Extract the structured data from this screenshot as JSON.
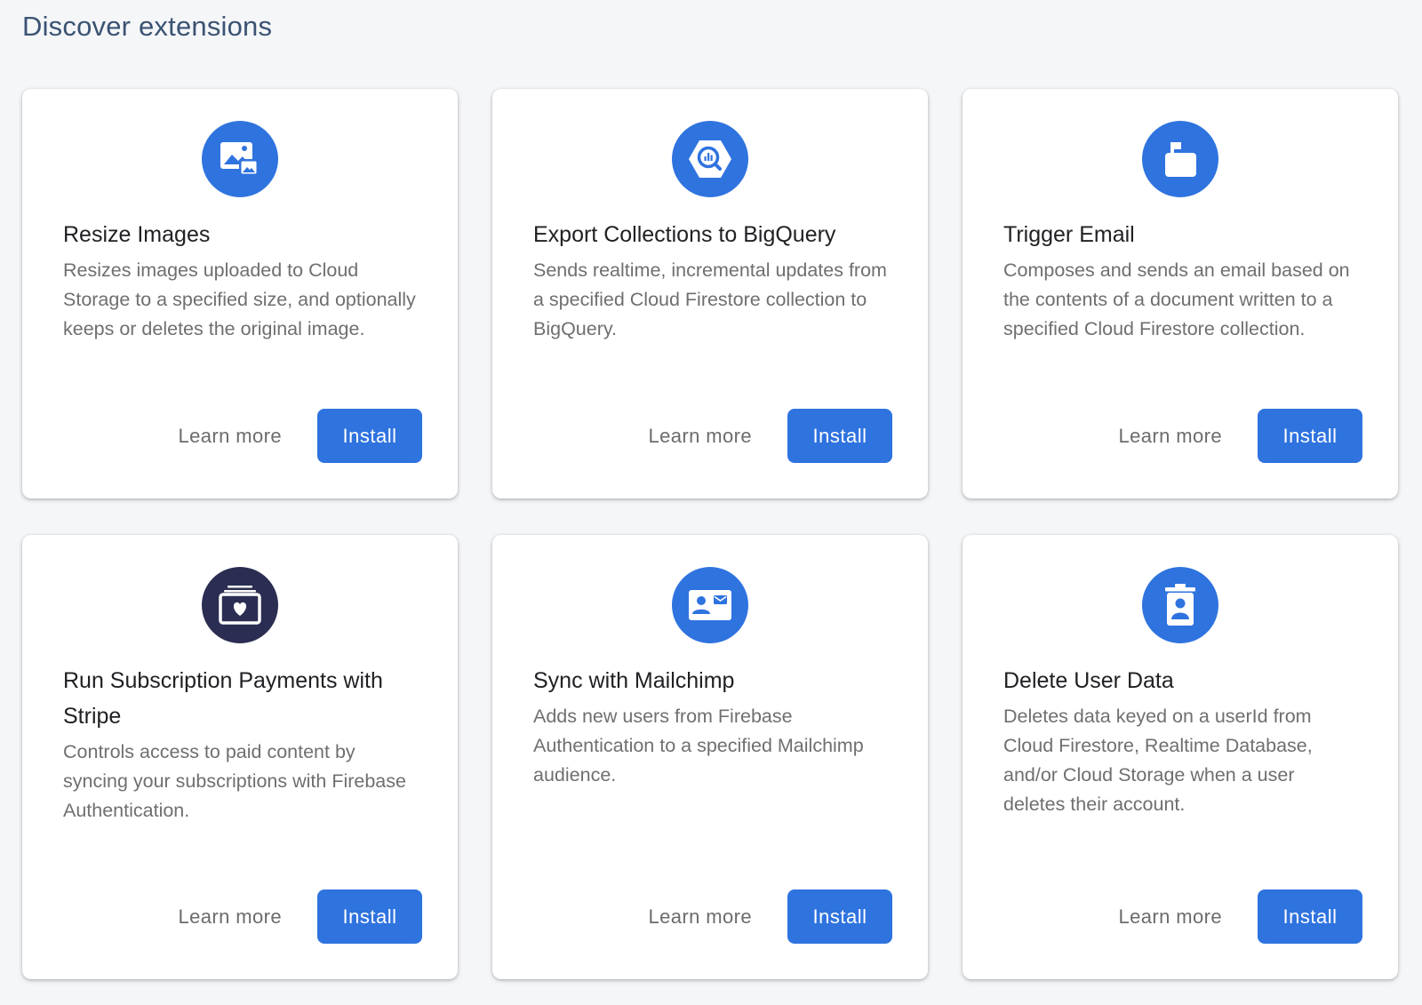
{
  "page": {
    "title": "Discover extensions"
  },
  "colors": {
    "background": "#f5f6f8",
    "title": "#3b5373",
    "accent_blue": "#2f73df",
    "dark_navy": "#2b2e52"
  },
  "cards": [
    {
      "icon": "image-resize-icon",
      "icon_color": "#2f73df",
      "title": "Resize Images",
      "description": "Resizes images uploaded to Cloud Storage to a specified size, and optionally keeps or deletes the original image.",
      "learn_more": "Learn more",
      "install": "Install"
    },
    {
      "icon": "bigquery-icon",
      "icon_color": "#2f73df",
      "title": "Export Collections to BigQuery",
      "description": "Sends realtime, incremental updates from a specified Cloud Firestore collection to BigQuery.",
      "learn_more": "Learn more",
      "install": "Install"
    },
    {
      "icon": "mailbox-icon",
      "icon_color": "#2f73df",
      "title": "Trigger Email",
      "description": "Composes and sends an email based on the contents of a document written to a specified Cloud Firestore collection.",
      "learn_more": "Learn more",
      "install": "Install"
    },
    {
      "icon": "subscription-heart-icon",
      "icon_color": "#2b2e52",
      "title": "Run Subscription Payments with Stripe",
      "description": "Controls access to paid content by syncing your subscriptions with Firebase Authentication.",
      "learn_more": "Learn more",
      "install": "Install"
    },
    {
      "icon": "contact-card-icon",
      "icon_color": "#2f73df",
      "title": "Sync with Mailchimp",
      "description": "Adds new users from Firebase Authentication to a specified Mailchimp audience.",
      "learn_more": "Learn more",
      "install": "Install"
    },
    {
      "icon": "delete-user-icon",
      "icon_color": "#2f73df",
      "title": "Delete User Data",
      "description": "Deletes data keyed on a userId from Cloud Firestore, Realtime Database, and/or Cloud Storage when a user deletes their account.",
      "learn_more": "Learn more",
      "install": "Install"
    }
  ]
}
